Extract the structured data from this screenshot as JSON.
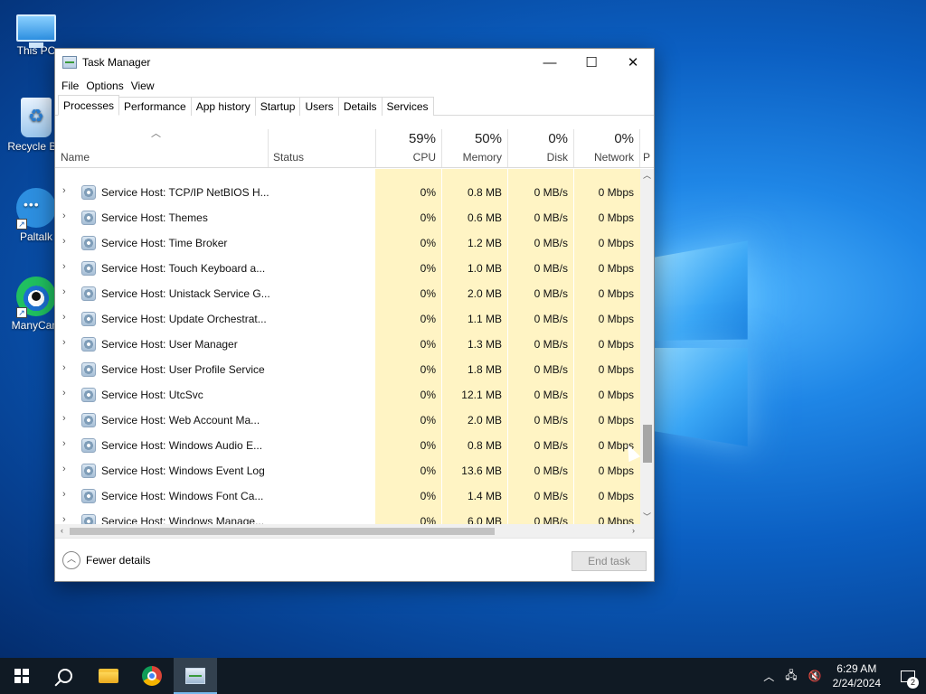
{
  "desktop": {
    "icons": [
      {
        "label": "This PC"
      },
      {
        "label": "Recycle Bin"
      },
      {
        "label": "Paltalk"
      },
      {
        "label": "ManyCam"
      }
    ]
  },
  "window": {
    "title": "Task Manager",
    "controls": {
      "minimize": "—",
      "maximize": "☐",
      "close": "✕"
    },
    "menu": [
      "File",
      "Options",
      "View"
    ],
    "tabs": [
      "Processes",
      "Performance",
      "App history",
      "Startup",
      "Users",
      "Details",
      "Services"
    ],
    "active_tab": "Processes"
  },
  "columns": {
    "name": "Name",
    "status": "Status",
    "cpu": {
      "pct": "59%",
      "label": "CPU"
    },
    "memory": {
      "pct": "50%",
      "label": "Memory"
    },
    "disk": {
      "pct": "0%",
      "label": "Disk"
    },
    "network": {
      "pct": "0%",
      "label": "Network"
    },
    "next": "P"
  },
  "rows": [
    {
      "name": "Service Host: TCP/IP NetBIOS H...",
      "cpu": "0%",
      "memory": "0.8 MB",
      "disk": "0 MB/s",
      "network": "0 Mbps"
    },
    {
      "name": "Service Host: Themes",
      "cpu": "0%",
      "memory": "0.6 MB",
      "disk": "0 MB/s",
      "network": "0 Mbps"
    },
    {
      "name": "Service Host: Time Broker",
      "cpu": "0%",
      "memory": "1.2 MB",
      "disk": "0 MB/s",
      "network": "0 Mbps"
    },
    {
      "name": "Service Host: Touch Keyboard a...",
      "cpu": "0%",
      "memory": "1.0 MB",
      "disk": "0 MB/s",
      "network": "0 Mbps"
    },
    {
      "name": "Service Host: Unistack Service G...",
      "cpu": "0%",
      "memory": "2.0 MB",
      "disk": "0 MB/s",
      "network": "0 Mbps"
    },
    {
      "name": "Service Host: Update Orchestrat...",
      "cpu": "0%",
      "memory": "1.1 MB",
      "disk": "0 MB/s",
      "network": "0 Mbps"
    },
    {
      "name": "Service Host: User Manager",
      "cpu": "0%",
      "memory": "1.3 MB",
      "disk": "0 MB/s",
      "network": "0 Mbps"
    },
    {
      "name": "Service Host: User Profile Service",
      "cpu": "0%",
      "memory": "1.8 MB",
      "disk": "0 MB/s",
      "network": "0 Mbps"
    },
    {
      "name": "Service Host: UtcSvc",
      "cpu": "0%",
      "memory": "12.1 MB",
      "disk": "0 MB/s",
      "network": "0 Mbps"
    },
    {
      "name": "Service Host: Web Account Ma...",
      "cpu": "0%",
      "memory": "2.0 MB",
      "disk": "0 MB/s",
      "network": "0 Mbps"
    },
    {
      "name": "Service Host: Windows Audio E...",
      "cpu": "0%",
      "memory": "0.8 MB",
      "disk": "0 MB/s",
      "network": "0 Mbps"
    },
    {
      "name": "Service Host: Windows Event Log",
      "cpu": "0%",
      "memory": "13.6 MB",
      "disk": "0 MB/s",
      "network": "0 Mbps"
    },
    {
      "name": "Service Host: Windows Font Ca...",
      "cpu": "0%",
      "memory": "1.4 MB",
      "disk": "0 MB/s",
      "network": "0 Mbps"
    },
    {
      "name": "Service Host: Windows Manage...",
      "cpu": "0%",
      "memory": "6.0 MB",
      "disk": "0 MB/s",
      "network": "0 Mbps"
    }
  ],
  "footer": {
    "fewer_details": "Fewer details",
    "end_task": "End task"
  },
  "taskbar": {
    "apps": [
      "start-icon",
      "search-icon",
      "file-explorer-icon",
      "chrome-icon",
      "task-manager-icon"
    ],
    "time": "6:29 AM",
    "date": "2/24/2024",
    "notification_count": "2"
  },
  "colors": {
    "highlight_column": "#fff4c4",
    "taskbar": "#101a24"
  }
}
